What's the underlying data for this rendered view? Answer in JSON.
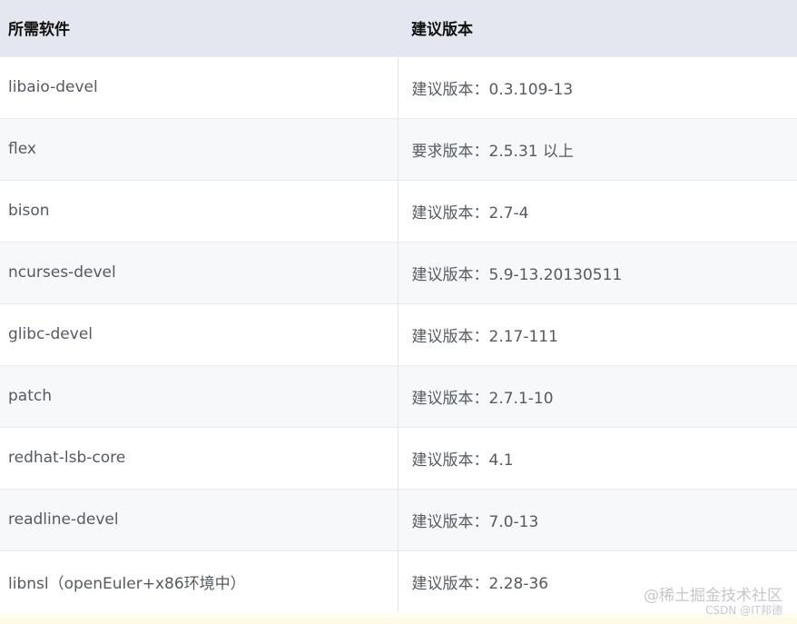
{
  "table": {
    "headers": [
      "所需软件",
      "建议版本"
    ],
    "rows": [
      [
        "libaio-devel",
        "建议版本：0.3.109-13"
      ],
      [
        "flex",
        "要求版本：2.5.31 以上"
      ],
      [
        "bison",
        "建议版本：2.7-4"
      ],
      [
        "ncurses-devel",
        "建议版本：5.9-13.20130511"
      ],
      [
        "glibc-devel",
        "建议版本：2.17-111"
      ],
      [
        "patch",
        "建议版本：2.7.1-10"
      ],
      [
        "redhat-lsb-core",
        "建议版本：4.1"
      ],
      [
        "readline-devel",
        "建议版本：7.0-13"
      ],
      [
        "libnsl（openEuler+x86环境中）",
        "建议版本：2.28-36"
      ]
    ]
  },
  "watermark": {
    "main": "@稀土掘金技术社区",
    "sub": "CSDN @IT邦德"
  },
  "colors": {
    "header_bg": "#e4e7ef",
    "row_alt_bg": "#f7f8fa",
    "text": "#555a60"
  }
}
